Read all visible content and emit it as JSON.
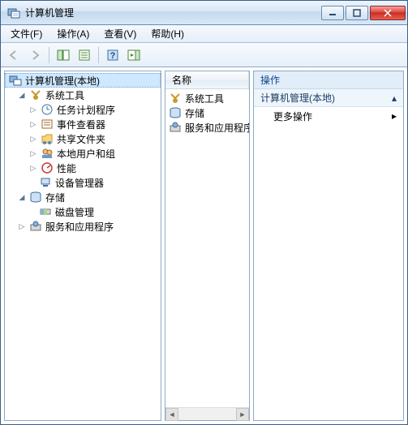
{
  "window": {
    "title": "计算机管理"
  },
  "menu": {
    "file": "文件(F)",
    "action": "操作(A)",
    "view": "查看(V)",
    "help": "帮助(H)"
  },
  "tree": {
    "root": "计算机管理(本地)",
    "system_tools": "系统工具",
    "task_scheduler": "任务计划程序",
    "event_viewer": "事件查看器",
    "shared_folders": "共享文件夹",
    "local_users": "本地用户和组",
    "performance": "性能",
    "device_manager": "设备管理器",
    "storage": "存储",
    "disk_mgmt": "磁盘管理",
    "services_apps": "服务和应用程序"
  },
  "mid": {
    "header": "名称",
    "items": {
      "system_tools": "系统工具",
      "storage": "存储",
      "services_apps": "服务和应用程序"
    }
  },
  "actions": {
    "header": "操作",
    "section": "计算机管理(本地)",
    "more": "更多操作"
  }
}
